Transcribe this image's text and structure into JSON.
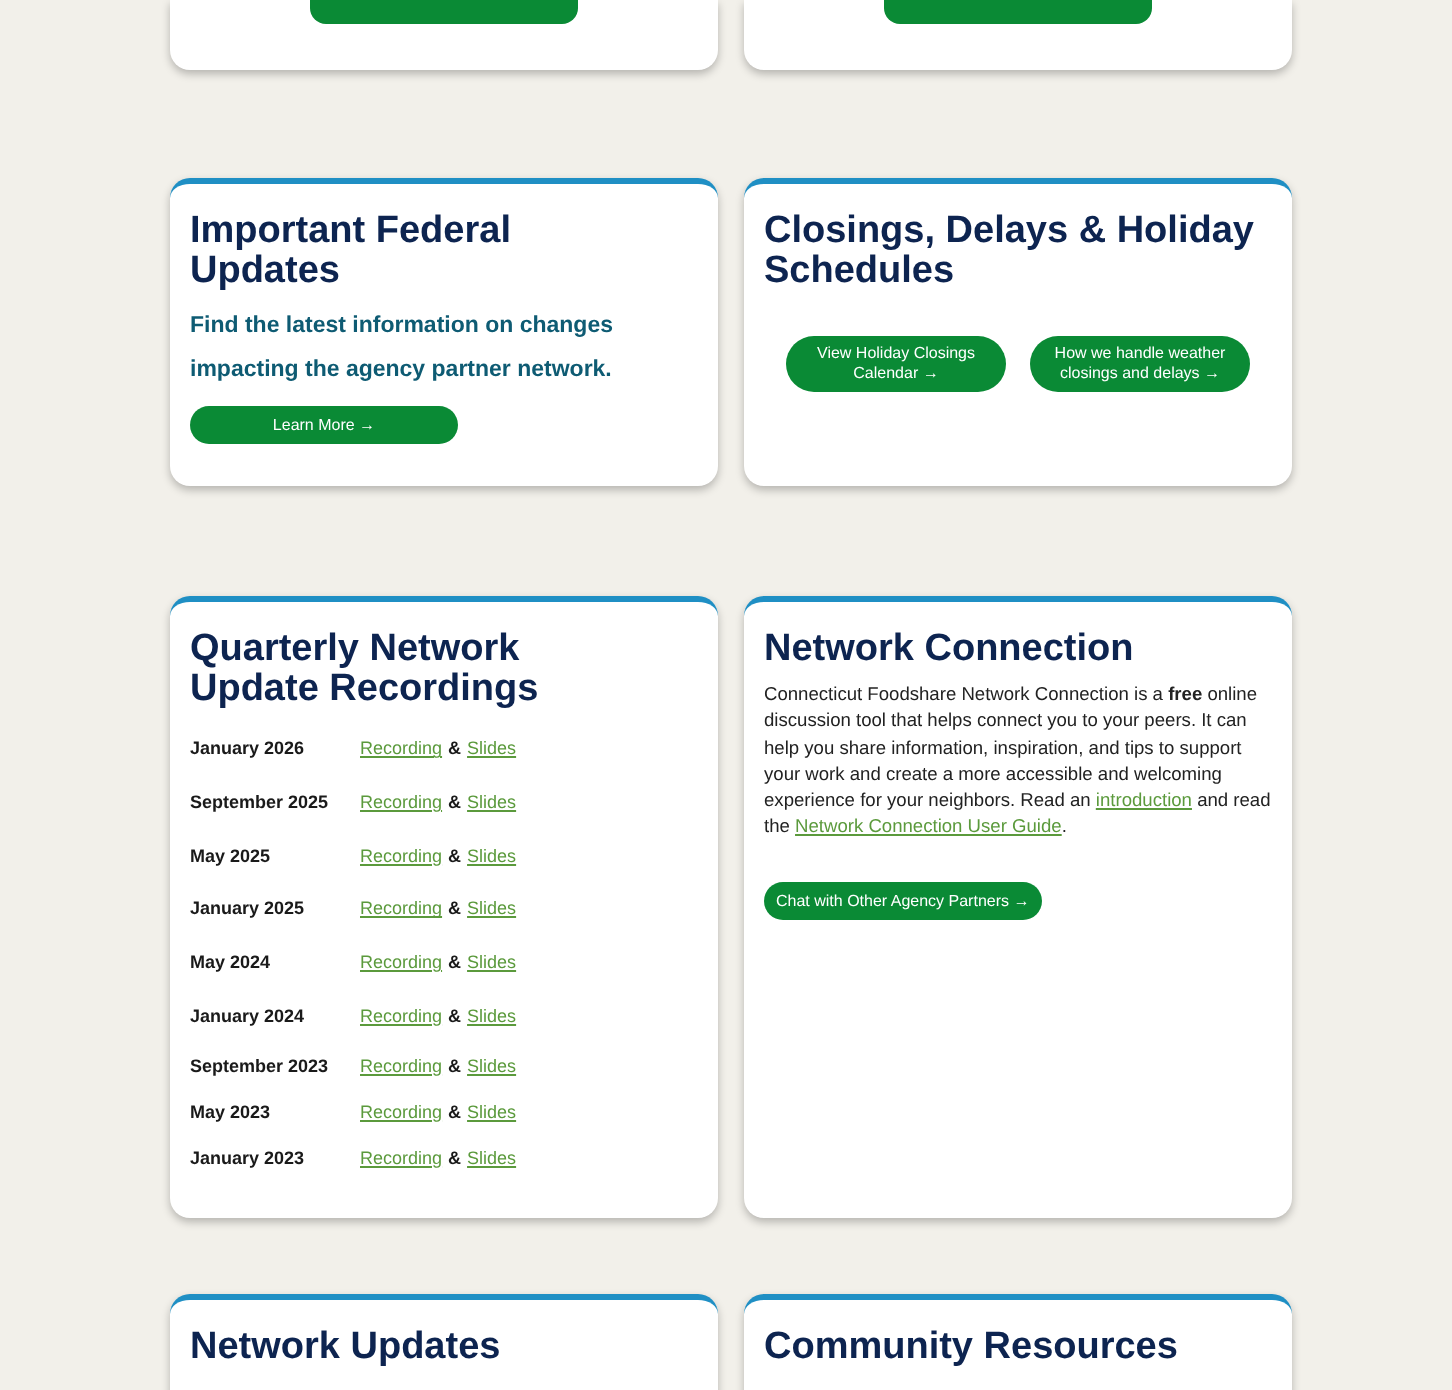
{
  "cut_cards": [
    {
      "kind": "button-card"
    },
    {
      "kind": "button-card"
    }
  ],
  "federal": {
    "title": "Important Federal Updates",
    "lead": "Find the latest information on changes impacting the agency partner network.",
    "button": "Learn More →"
  },
  "closings": {
    "title": "Closings, Delays & Holiday Schedules",
    "buttons": [
      "View Holiday Closings Calendar →",
      "How we handle weather closings and delays →"
    ]
  },
  "recordings": {
    "title": "Quarterly Network Update Recordings",
    "rows": [
      {
        "date": "January 2026",
        "link_1": "Recording",
        "joiner": "&",
        "link_2": "Slides"
      },
      {
        "date": "September 2025",
        "link_1": "Recording",
        "joiner": "&",
        "link_2": "Slides"
      },
      {
        "date": "May 2025",
        "link_1": "Recording",
        "joiner": "&",
        "link_2": "Slides"
      },
      {
        "date": "January 2025",
        "link_1": "Recording",
        "joiner": "&",
        "link_2": "Slides"
      },
      {
        "date": "May 2024",
        "link_1": "Recording",
        "joiner": "&",
        "link_2": "Slides"
      },
      {
        "date": "January 2024",
        "link_1": "Recording",
        "joiner": "&",
        "link_2": "Slides"
      },
      {
        "date": "September 2023",
        "link_1": "Recording",
        "joiner": "&",
        "link_2": "Slides"
      },
      {
        "date": "May 2023",
        "link_1": "Recording",
        "joiner": "&",
        "link_2": "Slides"
      },
      {
        "date": "January 2023",
        "link_1": "Recording",
        "joiner": "&",
        "link_2": "Slides"
      }
    ]
  },
  "connection": {
    "title": "Network Connection",
    "body": [
      {
        "kind": "text",
        "text": "Connecticut Foodshare Network Connection is a **free** online discussion tool that helps connect you to your peers. It can help you share information, inspiration, and tips to support your work and create a more accessible and welcoming experience for your neighbors. Read an "
      },
      {
        "kind": "link",
        "text": "introduction"
      },
      {
        "kind": "text",
        "text": " and read the "
      },
      {
        "kind": "link",
        "text": "Network Connection User Guide"
      },
      {
        "kind": "text",
        "text": "."
      }
    ],
    "button": "Chat with Other Agency Partners →"
  },
  "bottom_cards": [
    {
      "title": "Network Updates"
    },
    {
      "title": "Community Resources"
    }
  ]
}
